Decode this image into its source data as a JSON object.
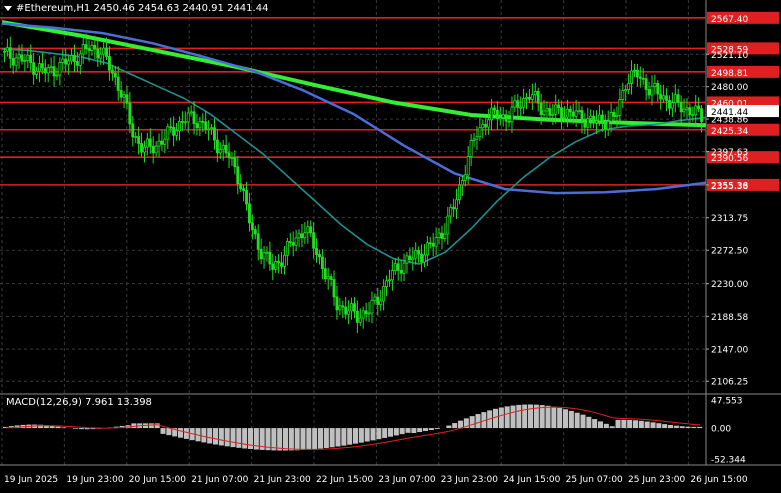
{
  "header": {
    "symbol": "#Ethereum,H1",
    "ohlc": "2450.46 2454.63 2440.91 2441.44",
    "menu_icon": "triangle-down-icon"
  },
  "colors": {
    "background": "#000000",
    "grid": "#3a3a3a",
    "candle": "#22dd22",
    "level_line": "#e02020",
    "ma_fast": "#1f8f8f",
    "ma_mid": "#4a6ed8",
    "ma_slow": "#33ee33",
    "macd_hist": "#c0c0c0",
    "macd_signal": "#e02020"
  },
  "price_axis": {
    "ticks": [
      "2521.10",
      "2480.00",
      "2438.86",
      "2397.63",
      "2355.36",
      "2313.75",
      "2272.50",
      "2230.00",
      "2188.58",
      "2147.00",
      "2106.25"
    ],
    "current_price": "2441.44"
  },
  "levels": [
    {
      "label": "2567.40",
      "value": 2567.4
    },
    {
      "label": "2528.59",
      "value": 2528.59
    },
    {
      "label": "2498.81",
      "value": 2498.81
    },
    {
      "label": "2460.01",
      "value": 2460.01
    },
    {
      "label": "2425.34",
      "value": 2425.34
    },
    {
      "label": "2390.56",
      "value": 2390.56
    },
    {
      "label": "2355.38",
      "value": 2355.38
    }
  ],
  "time_axis": {
    "labels": [
      "19 Jun 2025",
      "19 Jun 23:00",
      "20 Jun 15:00",
      "21 Jun 07:00",
      "21 Jun 23:00",
      "22 Jun 15:00",
      "23 Jun 07:00",
      "23 Jun 23:00",
      "24 Jun 15:00",
      "25 Jun 07:00",
      "25 Jun 23:00",
      "26 Jun 15:00"
    ]
  },
  "macd": {
    "label": "MACD(12,26,9) 7.961 13.398",
    "ticks": [
      "47.553",
      "0.00",
      "-52.344"
    ]
  },
  "chart_data": {
    "type": "candlestick",
    "series": [
      {
        "name": "#Ethereum,H1",
        "values_close": [
          2520,
          2518,
          2512,
          2505,
          2498,
          2505,
          2512,
          2520,
          2530,
          2525,
          2500,
          2470,
          2420,
          2400,
          2405,
          2415,
          2430,
          2440,
          2438,
          2425,
          2405,
          2390,
          2360,
          2300,
          2270,
          2250,
          2265,
          2285,
          2300,
          2275,
          2240,
          2205,
          2195,
          2190,
          2195,
          2215,
          2240,
          2255,
          2262,
          2270,
          2280,
          2300,
          2330,
          2380,
          2420,
          2440,
          2445,
          2440,
          2460,
          2470,
          2455,
          2445,
          2450,
          2445,
          2440,
          2435,
          2438,
          2440,
          2490,
          2495,
          2480,
          2470,
          2462,
          2455,
          2450,
          2441
        ]
      },
      {
        "name": "MA fast",
        "values": [
          2528,
          2526,
          2522,
          2518,
          2510,
          2495,
          2480,
          2465,
          2445,
          2420,
          2395,
          2365,
          2335,
          2305,
          2280,
          2262,
          2255,
          2270,
          2300,
          2335,
          2365,
          2390,
          2410,
          2425,
          2430,
          2432,
          2437,
          2441
        ]
      },
      {
        "name": "MA mid",
        "values": [
          2560,
          2555,
          2548,
          2535,
          2518,
          2500,
          2475,
          2445,
          2405,
          2370,
          2350,
          2345,
          2346,
          2350,
          2358
        ]
      },
      {
        "name": "MA slow",
        "values": [
          2562,
          2545,
          2525,
          2505,
          2482,
          2460,
          2444,
          2438,
          2434,
          2431
        ]
      }
    ],
    "macd": {
      "main": 7.961,
      "signal": 13.398
    }
  }
}
